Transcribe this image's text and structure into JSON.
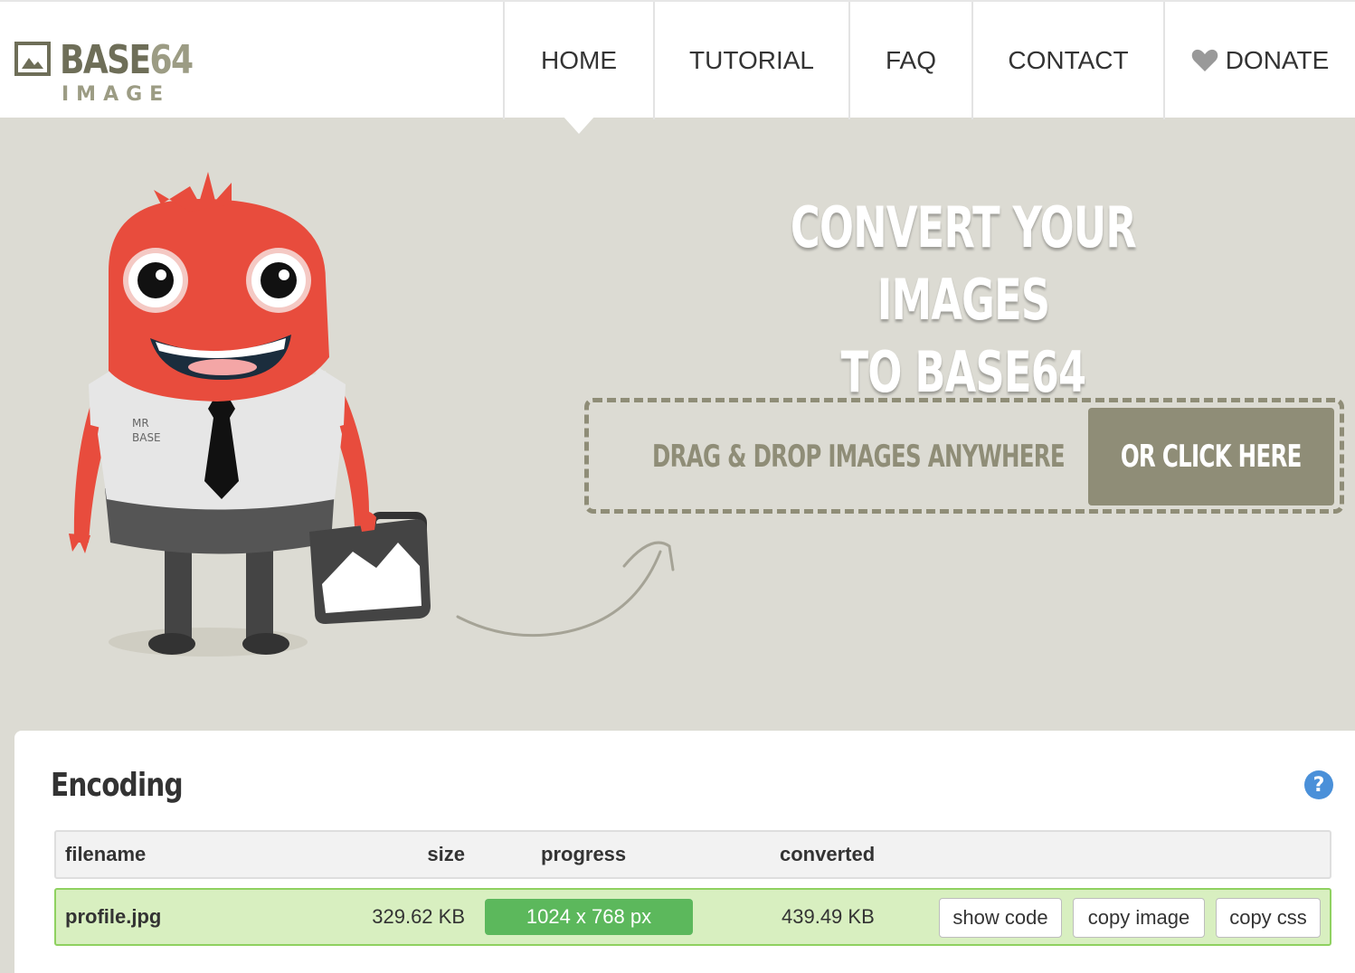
{
  "logo": {
    "text_main": "BASE",
    "text_num": "64",
    "text_sub": "IMAGE"
  },
  "nav": {
    "home": "HOME",
    "tutorial": "TUTORIAL",
    "faq": "FAQ",
    "contact": "CONTACT",
    "donate": "DONATE"
  },
  "hero": {
    "title_line1": "CONVERT YOUR IMAGES",
    "title_line2": "TO BASE64",
    "drop_text": "DRAG & DROP IMAGES ANYWHERE",
    "click_text": "OR CLICK HERE",
    "mascot_shirt_text": "MR BASE"
  },
  "encoding": {
    "title": "Encoding",
    "help": "?",
    "columns": {
      "filename": "filename",
      "size": "size",
      "progress": "progress",
      "converted": "converted"
    },
    "rows": [
      {
        "filename": "profile.jpg",
        "size": "329.62 KB",
        "progress_label": "1024 x 768 px",
        "progress_fraction": 1.0,
        "converted": "439.49 KB",
        "show_code": "show code",
        "copy_image": "copy image",
        "copy_css": "copy css"
      }
    ]
  },
  "colors": {
    "background": "#dcdbd3",
    "accent_olive": "#8f8d77",
    "progress_green": "#5cb85c",
    "row_bg": "#d8efc0",
    "mascot_red": "#e84c3d"
  }
}
